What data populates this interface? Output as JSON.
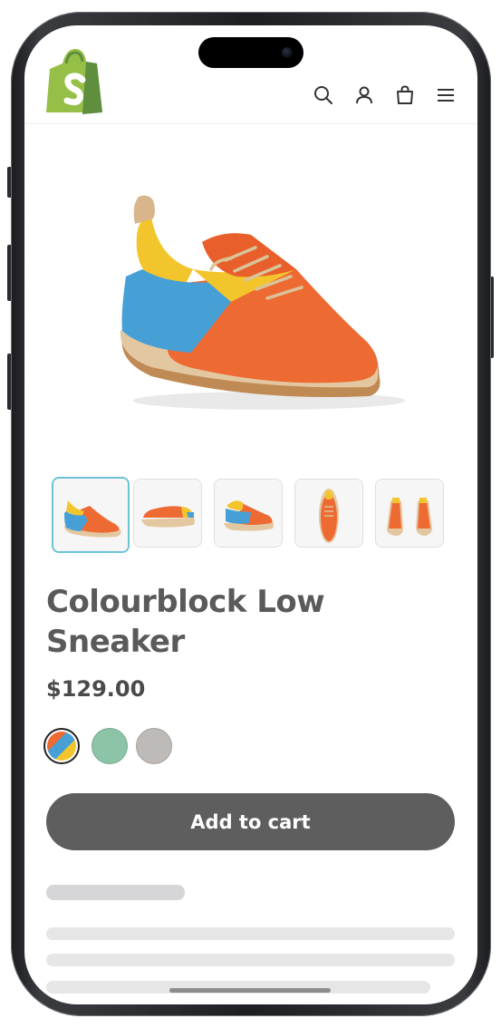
{
  "store": {
    "logo": "shopify-bag-logo",
    "brand_color": "#95bf47"
  },
  "header": {
    "icons": [
      "search-icon",
      "account-icon",
      "cart-icon",
      "menu-icon"
    ]
  },
  "product": {
    "title": "Colourblock Low Sneaker",
    "price": "$129.00",
    "swatch_colors": [
      "multicolor",
      "#8dc4a7",
      "#bdbab7"
    ],
    "thumbnails": [
      "three-quarter-view",
      "side-view",
      "rear-view",
      "top-view",
      "pair-view"
    ],
    "selected_thumbnail": 0,
    "selected_swatch": 0
  },
  "actions": {
    "add_to_cart_label": "Add to cart"
  },
  "colors": {
    "accent_button": "#5e5e5e",
    "active_thumb_border": "#6cc3d7",
    "text": "#5a5a5a"
  }
}
